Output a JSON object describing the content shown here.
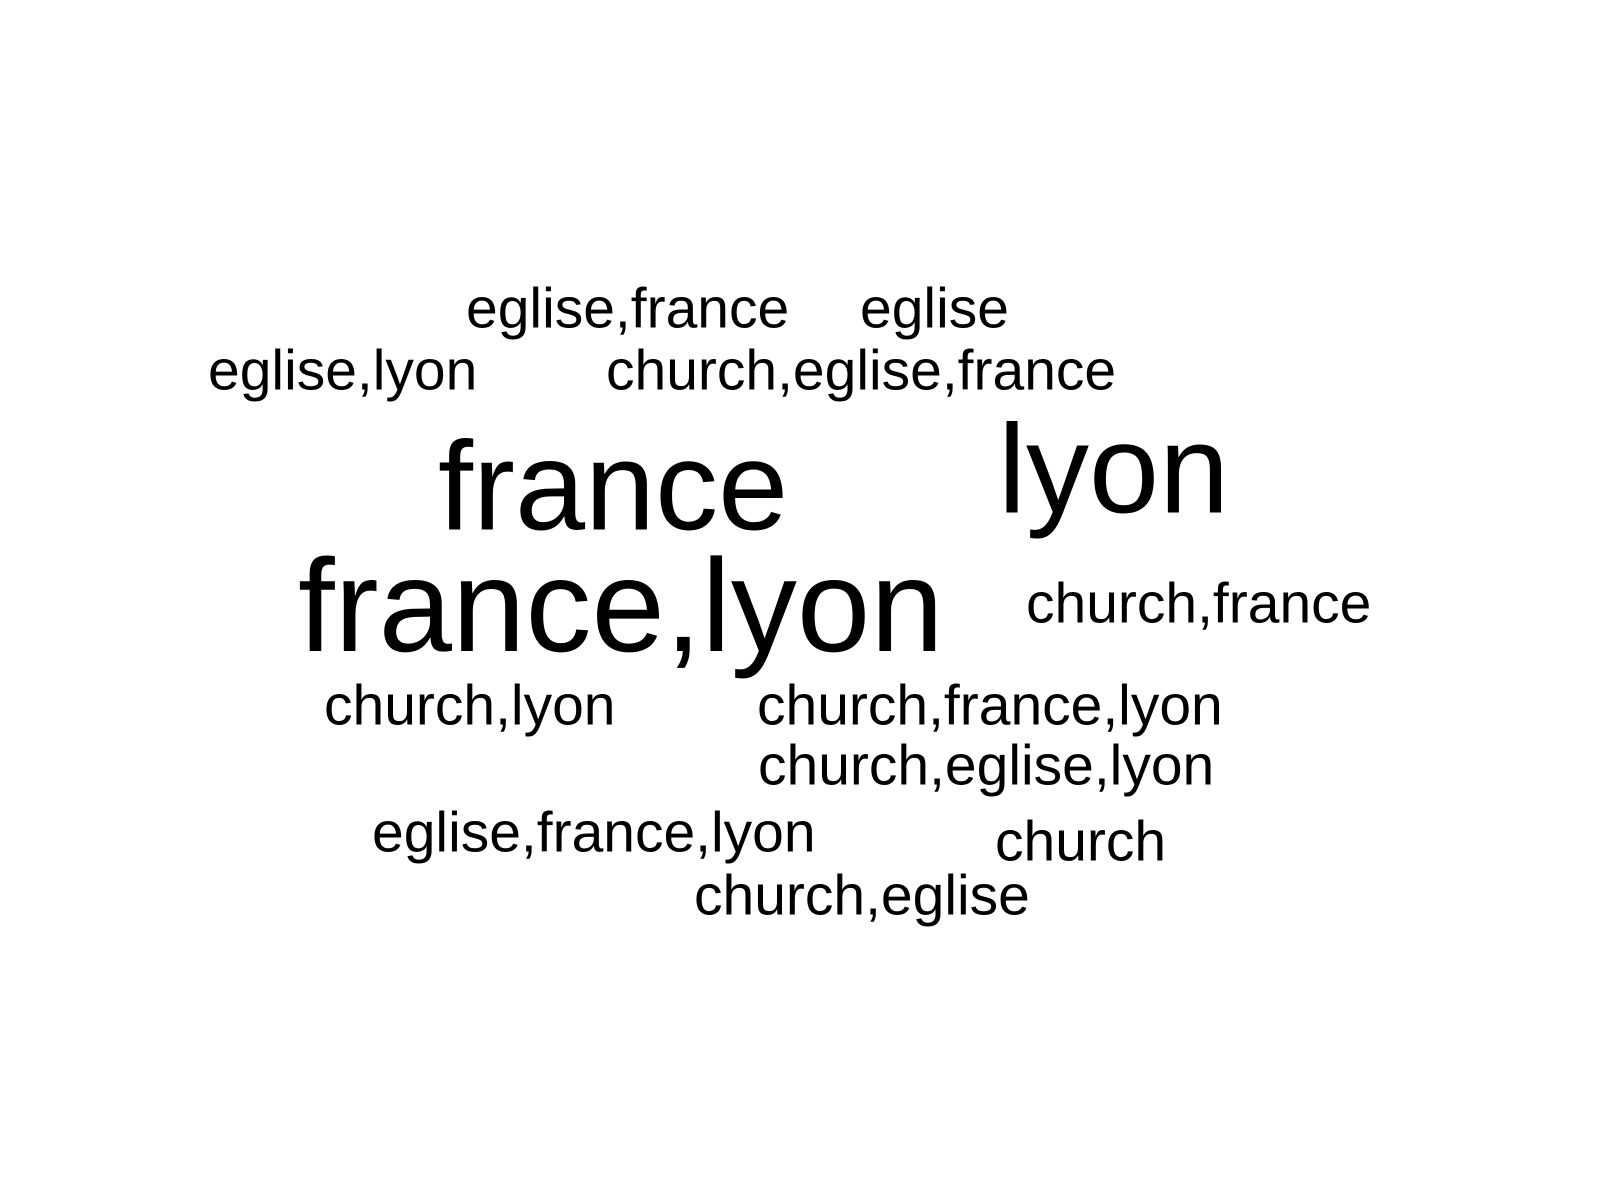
{
  "cloud": {
    "words": {
      "eglise_france": "eglise,france",
      "eglise": "eglise",
      "eglise_lyon": "eglise,lyon",
      "church_eglise_france": "church,eglise,france",
      "france": "france",
      "lyon": "lyon",
      "france_lyon": "france,lyon",
      "church_france": "church,france",
      "church_lyon": "church,lyon",
      "church_france_lyon": "church,france,lyon",
      "church_eglise_lyon": "church,eglise,lyon",
      "eglise_france_lyon": "eglise,france,lyon",
      "church": "church",
      "church_eglise": "church,eglise"
    },
    "text_color": "#000000",
    "background_color": "#ffffff"
  }
}
